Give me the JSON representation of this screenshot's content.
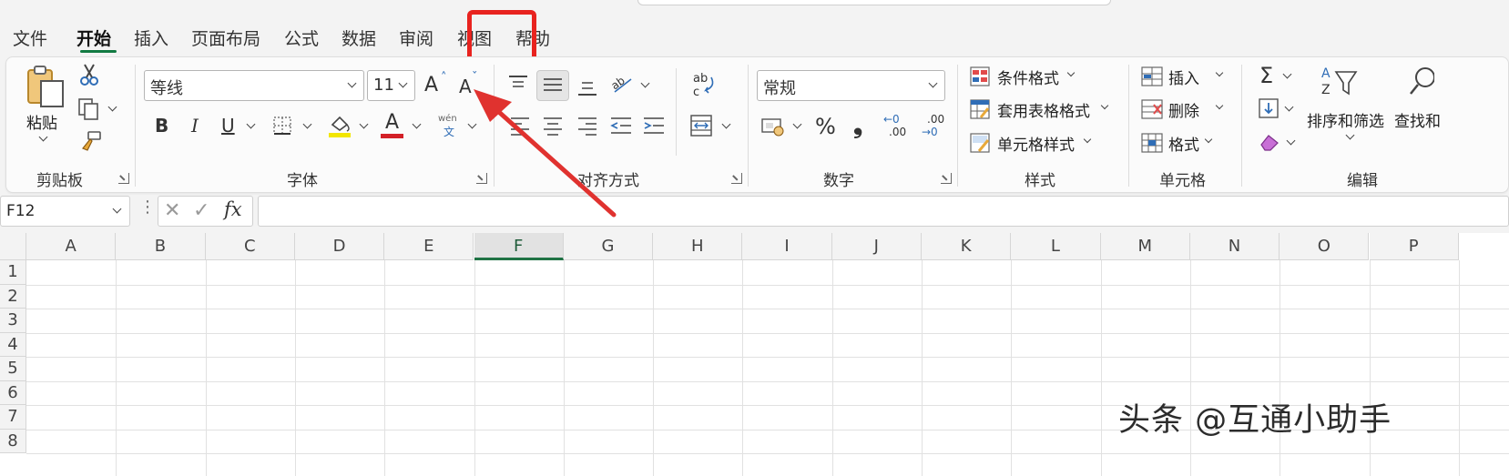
{
  "tabs": [
    "文件",
    "开始",
    "插入",
    "页面布局",
    "公式",
    "数据",
    "审阅",
    "视图",
    "帮助"
  ],
  "active_tab": "开始",
  "highlighted_tab": "视图",
  "clipboard": {
    "paste_label": "粘贴",
    "group_label": "剪贴板"
  },
  "font": {
    "font_name": "等线",
    "font_size": "11",
    "grow_label": "A",
    "shrink_label": "A",
    "bold": "B",
    "italic": "I",
    "underline": "U",
    "font_color_letter": "A",
    "phonetic_top": "wén",
    "phonetic_bottom": "文",
    "group_label": "字体"
  },
  "alignment": {
    "wrap_glyph": "ab\nc",
    "group_label": "对齐方式"
  },
  "number": {
    "format": "常规",
    "percent": "%",
    "comma": "❟",
    "inc_decimal_top": "←0",
    "inc_decimal_bottom": ".00",
    "dec_decimal_top": ".00",
    "dec_decimal_bottom": "→0",
    "group_label": "数字"
  },
  "styles": {
    "items": [
      "条件格式",
      "套用表格格式",
      "单元格样式"
    ],
    "group_label": "样式"
  },
  "cells": {
    "items": [
      "插入",
      "删除",
      "格式"
    ],
    "group_label": "单元格"
  },
  "editing": {
    "sigma": "Σ",
    "sort_filter": "排序和筛选",
    "find": "查找和",
    "group_label": "编辑"
  },
  "formula_bar": {
    "name_box": "F12",
    "fx": "fx",
    "formula": ""
  },
  "columns": [
    "A",
    "B",
    "C",
    "D",
    "E",
    "F",
    "G",
    "H",
    "I",
    "J",
    "K",
    "L",
    "M",
    "N",
    "O",
    "P"
  ],
  "selected_column": "F",
  "rows": [
    "1",
    "2",
    "3",
    "4",
    "5",
    "6",
    "7",
    "8"
  ],
  "watermark": "头条 @互通小助手",
  "colors": {
    "accent": "#1f7244",
    "highlight_box": "#e8231f",
    "arrow": "#e0322f",
    "fill_yellow": "#f2e600",
    "font_red": "#d32027"
  }
}
